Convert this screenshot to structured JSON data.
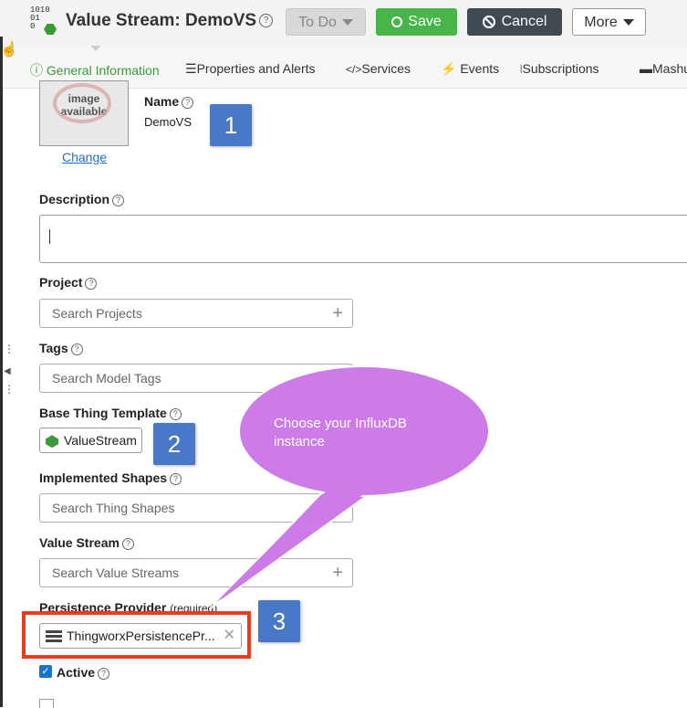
{
  "header": {
    "icon_text": [
      "1010",
      "01",
      "0"
    ],
    "title": "Value Stream: DemoVS",
    "help_glyph": "?",
    "state_button": "To Do",
    "save_button": "Save",
    "cancel_button": "Cancel",
    "more_button": "More"
  },
  "tabs": [
    {
      "label": "General Information",
      "icon": "info-icon",
      "active": true
    },
    {
      "label": "Properties and Alerts",
      "icon": "list-icon"
    },
    {
      "label": "Services",
      "icon": "code-icon",
      "icon_text": "</>"
    },
    {
      "label": "Events",
      "icon": "lightning-icon"
    },
    {
      "label": "Subscriptions",
      "icon": "feed-icon"
    },
    {
      "label": "Mashups",
      "icon": "mashup-icon"
    }
  ],
  "general": {
    "image_placeholder": [
      "image",
      "available"
    ],
    "change_link": "Change",
    "name_label": "Name",
    "name_value": "DemoVS",
    "description_label": "Description",
    "description_value": "",
    "project_label": "Project",
    "project_placeholder": "Search Projects",
    "tags_label": "Tags",
    "tags_placeholder": "Search Model Tags",
    "base_template_label": "Base Thing Template",
    "base_template_value": "ValueStream",
    "shapes_label": "Implemented Shapes",
    "shapes_placeholder": "Search Thing Shapes",
    "value_stream_label": "Value Stream",
    "value_stream_placeholder": "Search Value Streams",
    "persistence_label": "Persistence Provider",
    "persistence_required": "(required)",
    "persistence_value": "ThingworxPersistencePr...",
    "active_label": "Active",
    "active_checked": true
  },
  "annotations": {
    "markers": [
      "1",
      "2",
      "3"
    ],
    "callout": "Choose your InfluxDB instance",
    "marker_color": "#4a78c8",
    "callout_color": "#cc7be8",
    "highlight_color": "#ee3b1c"
  }
}
